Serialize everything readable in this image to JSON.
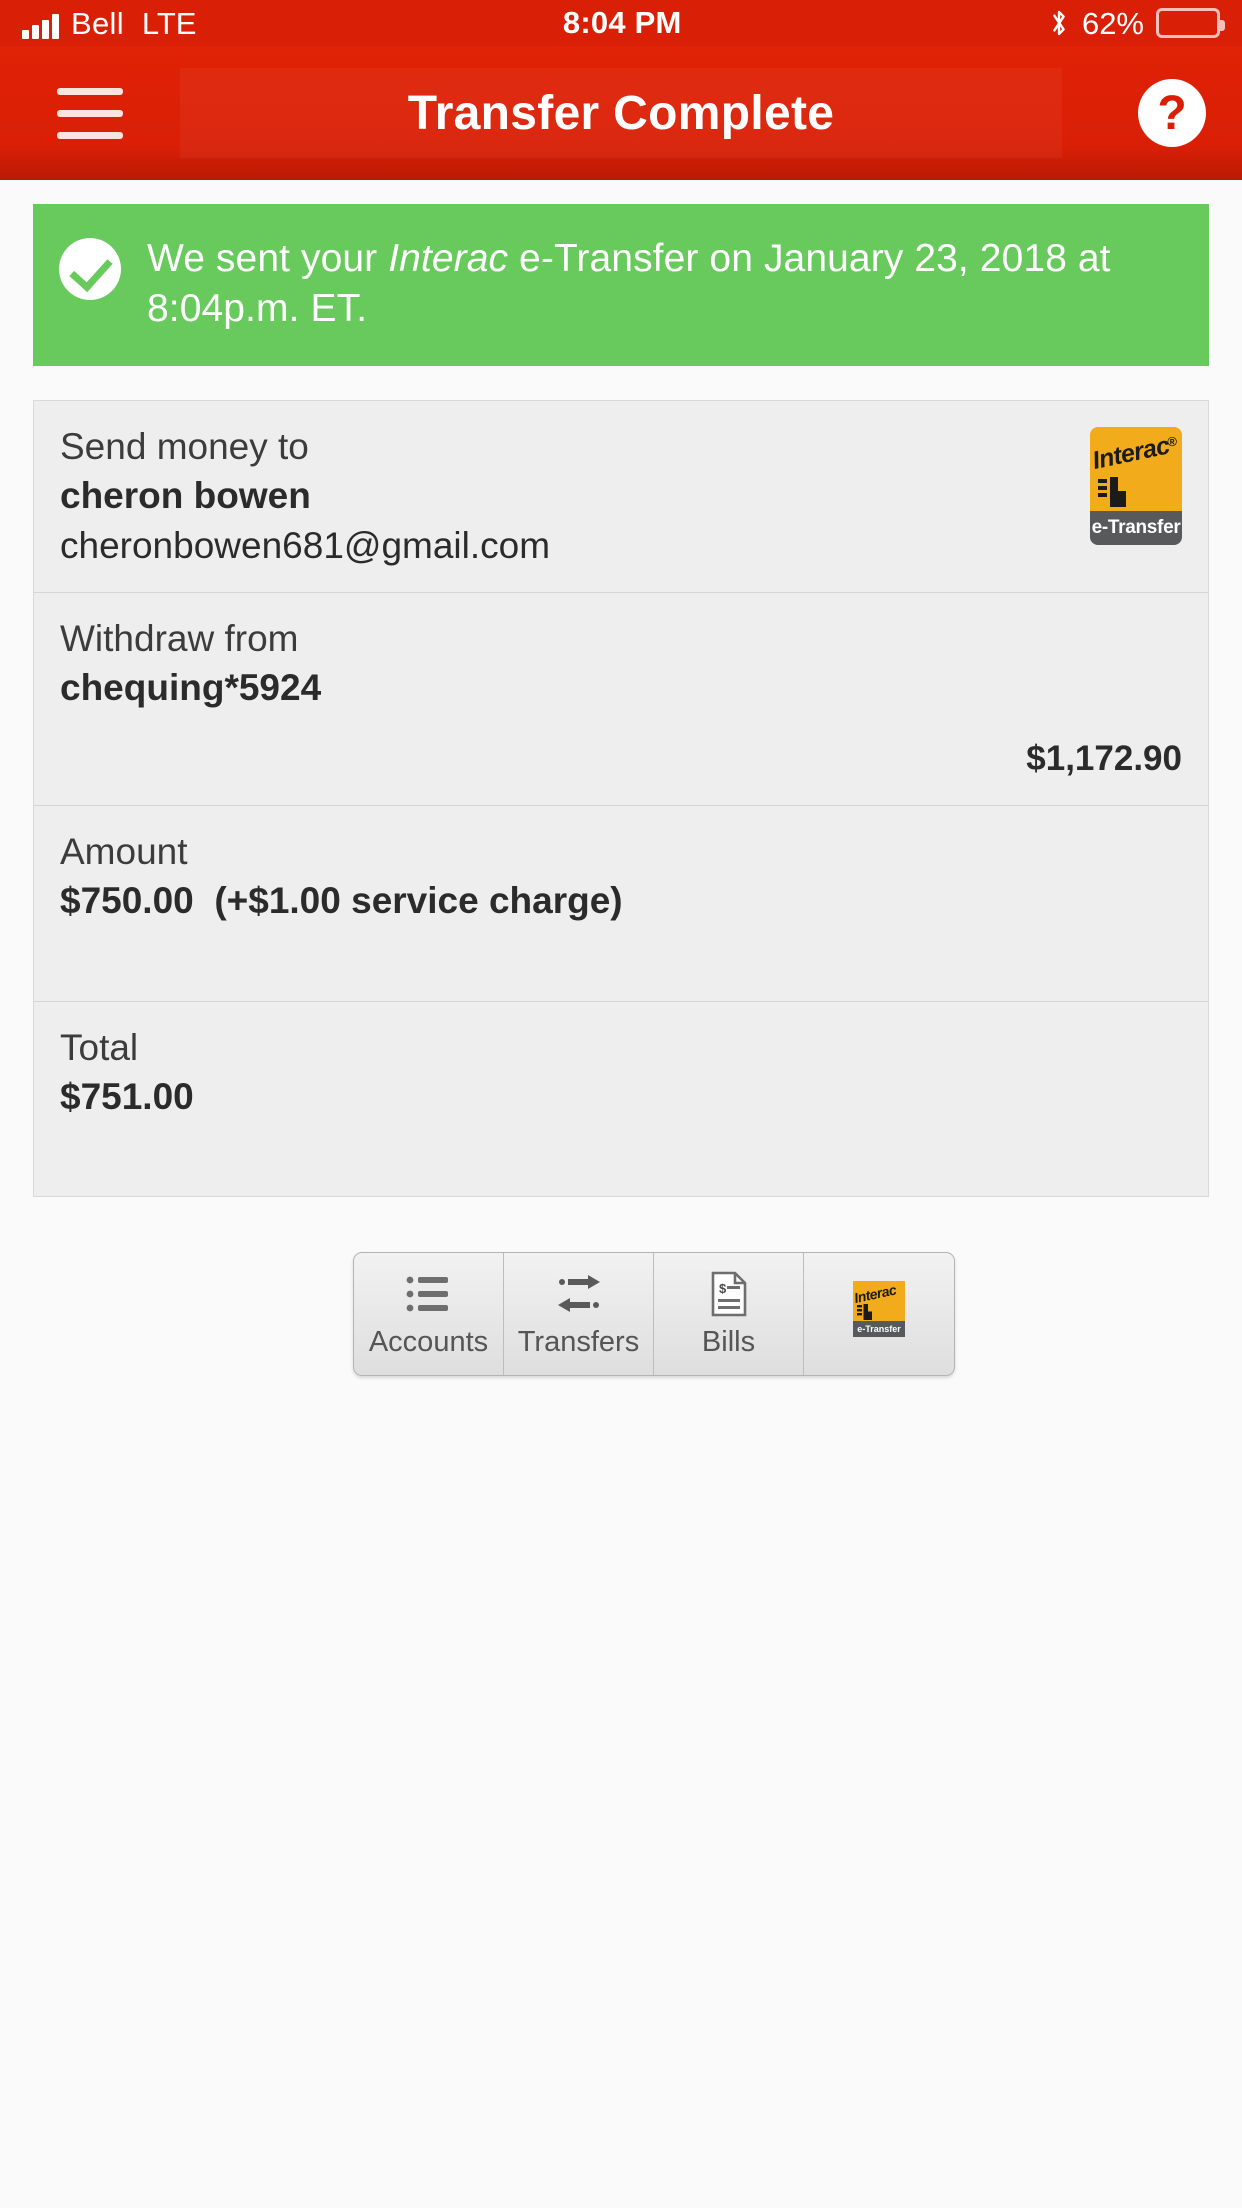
{
  "status_bar": {
    "carrier": "Bell",
    "network": "LTE",
    "time": "8:04 PM",
    "battery_percent": "62%",
    "battery_level": 62,
    "bluetooth_icon": "bluetooth-icon",
    "signal_icon": "signal-bars-icon",
    "battery_icon": "battery-icon"
  },
  "app_bar": {
    "menu_icon": "hamburger-menu-icon",
    "title": "Transfer Complete",
    "help_icon": "help-question-icon",
    "help_glyph": "?"
  },
  "alert": {
    "icon": "success-check-icon",
    "text_before": "We sent your ",
    "brand": "Interac",
    "text_after": " e-Transfer on January 23, 2018 at 8:04p.m. ET.",
    "color": "#68ca5c"
  },
  "interac_badge": {
    "word": "Interac",
    "registered": "®",
    "subtitle": "e-Transfer",
    "orange": "#f2ab1b",
    "gray": "#58595b"
  },
  "details": {
    "recipient": {
      "label": "Send money to",
      "name": "cheron bowen",
      "email": "cheronbowen681@gmail.com"
    },
    "withdraw": {
      "label": "Withdraw from",
      "account": "chequing*5924",
      "balance": "$1,172.90"
    },
    "amount": {
      "label": "Amount",
      "value": "$750.00",
      "service_charge": "(+$1.00 service charge)"
    },
    "total": {
      "label": "Total",
      "value": "$751.00"
    }
  },
  "tabbar": {
    "tabs": [
      {
        "label": "Accounts",
        "icon": "list-bullets-icon"
      },
      {
        "label": "Transfers",
        "icon": "transfer-arrows-icon"
      },
      {
        "label": "Bills",
        "icon": "bill-document-icon"
      },
      {
        "label": "",
        "icon": "interac-etransfer-icon"
      }
    ]
  },
  "theme": {
    "brand_red": "#d91f06",
    "success_green": "#68ca5c",
    "card_gray": "#eeeeee"
  }
}
